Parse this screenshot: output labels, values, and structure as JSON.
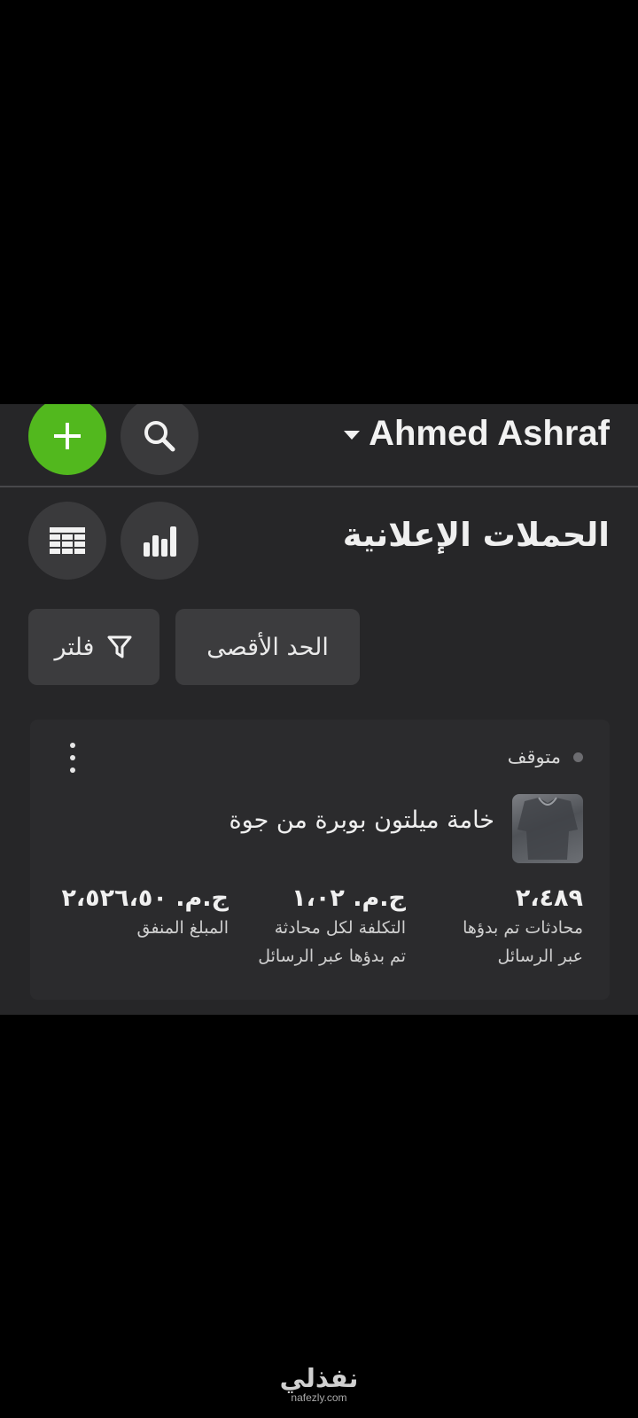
{
  "header": {
    "account_name": "Ahmed Ashraf"
  },
  "page": {
    "title": "الحملات الإعلانية"
  },
  "toolbar": {
    "filter_label": "فلتر",
    "limit_label": "الحد الأقصى"
  },
  "campaign": {
    "status": "متوقف",
    "name": "خامة ميلتون بوبرة من جوة",
    "metrics": [
      {
        "value": "٢،٤٨٩",
        "label_line1": "محادثات تم بدؤها",
        "label_line2": "عبر الرسائل"
      },
      {
        "value": "ج.م. ١،٠٢",
        "label_line1": "التكلفة لكل محادثة",
        "label_line2": "تم بدؤها عبر الرسائل"
      },
      {
        "value": "ج.م. ٢،٥٢٦،٥٠",
        "label_line1": "المبلغ المنفق",
        "label_line2": ""
      }
    ]
  },
  "watermark": {
    "arabic": "نفذلي",
    "url": "nafezly.com"
  },
  "colors": {
    "add_button": "#52b81e",
    "panel_background": "#262628",
    "card_background": "#2b2b2d",
    "chip_background": "#3c3c3e"
  },
  "icons": [
    "plus-icon",
    "search-icon",
    "table-icon",
    "bar-chart-icon",
    "filter-icon",
    "more-vertical-icon",
    "caret-down-icon"
  ]
}
